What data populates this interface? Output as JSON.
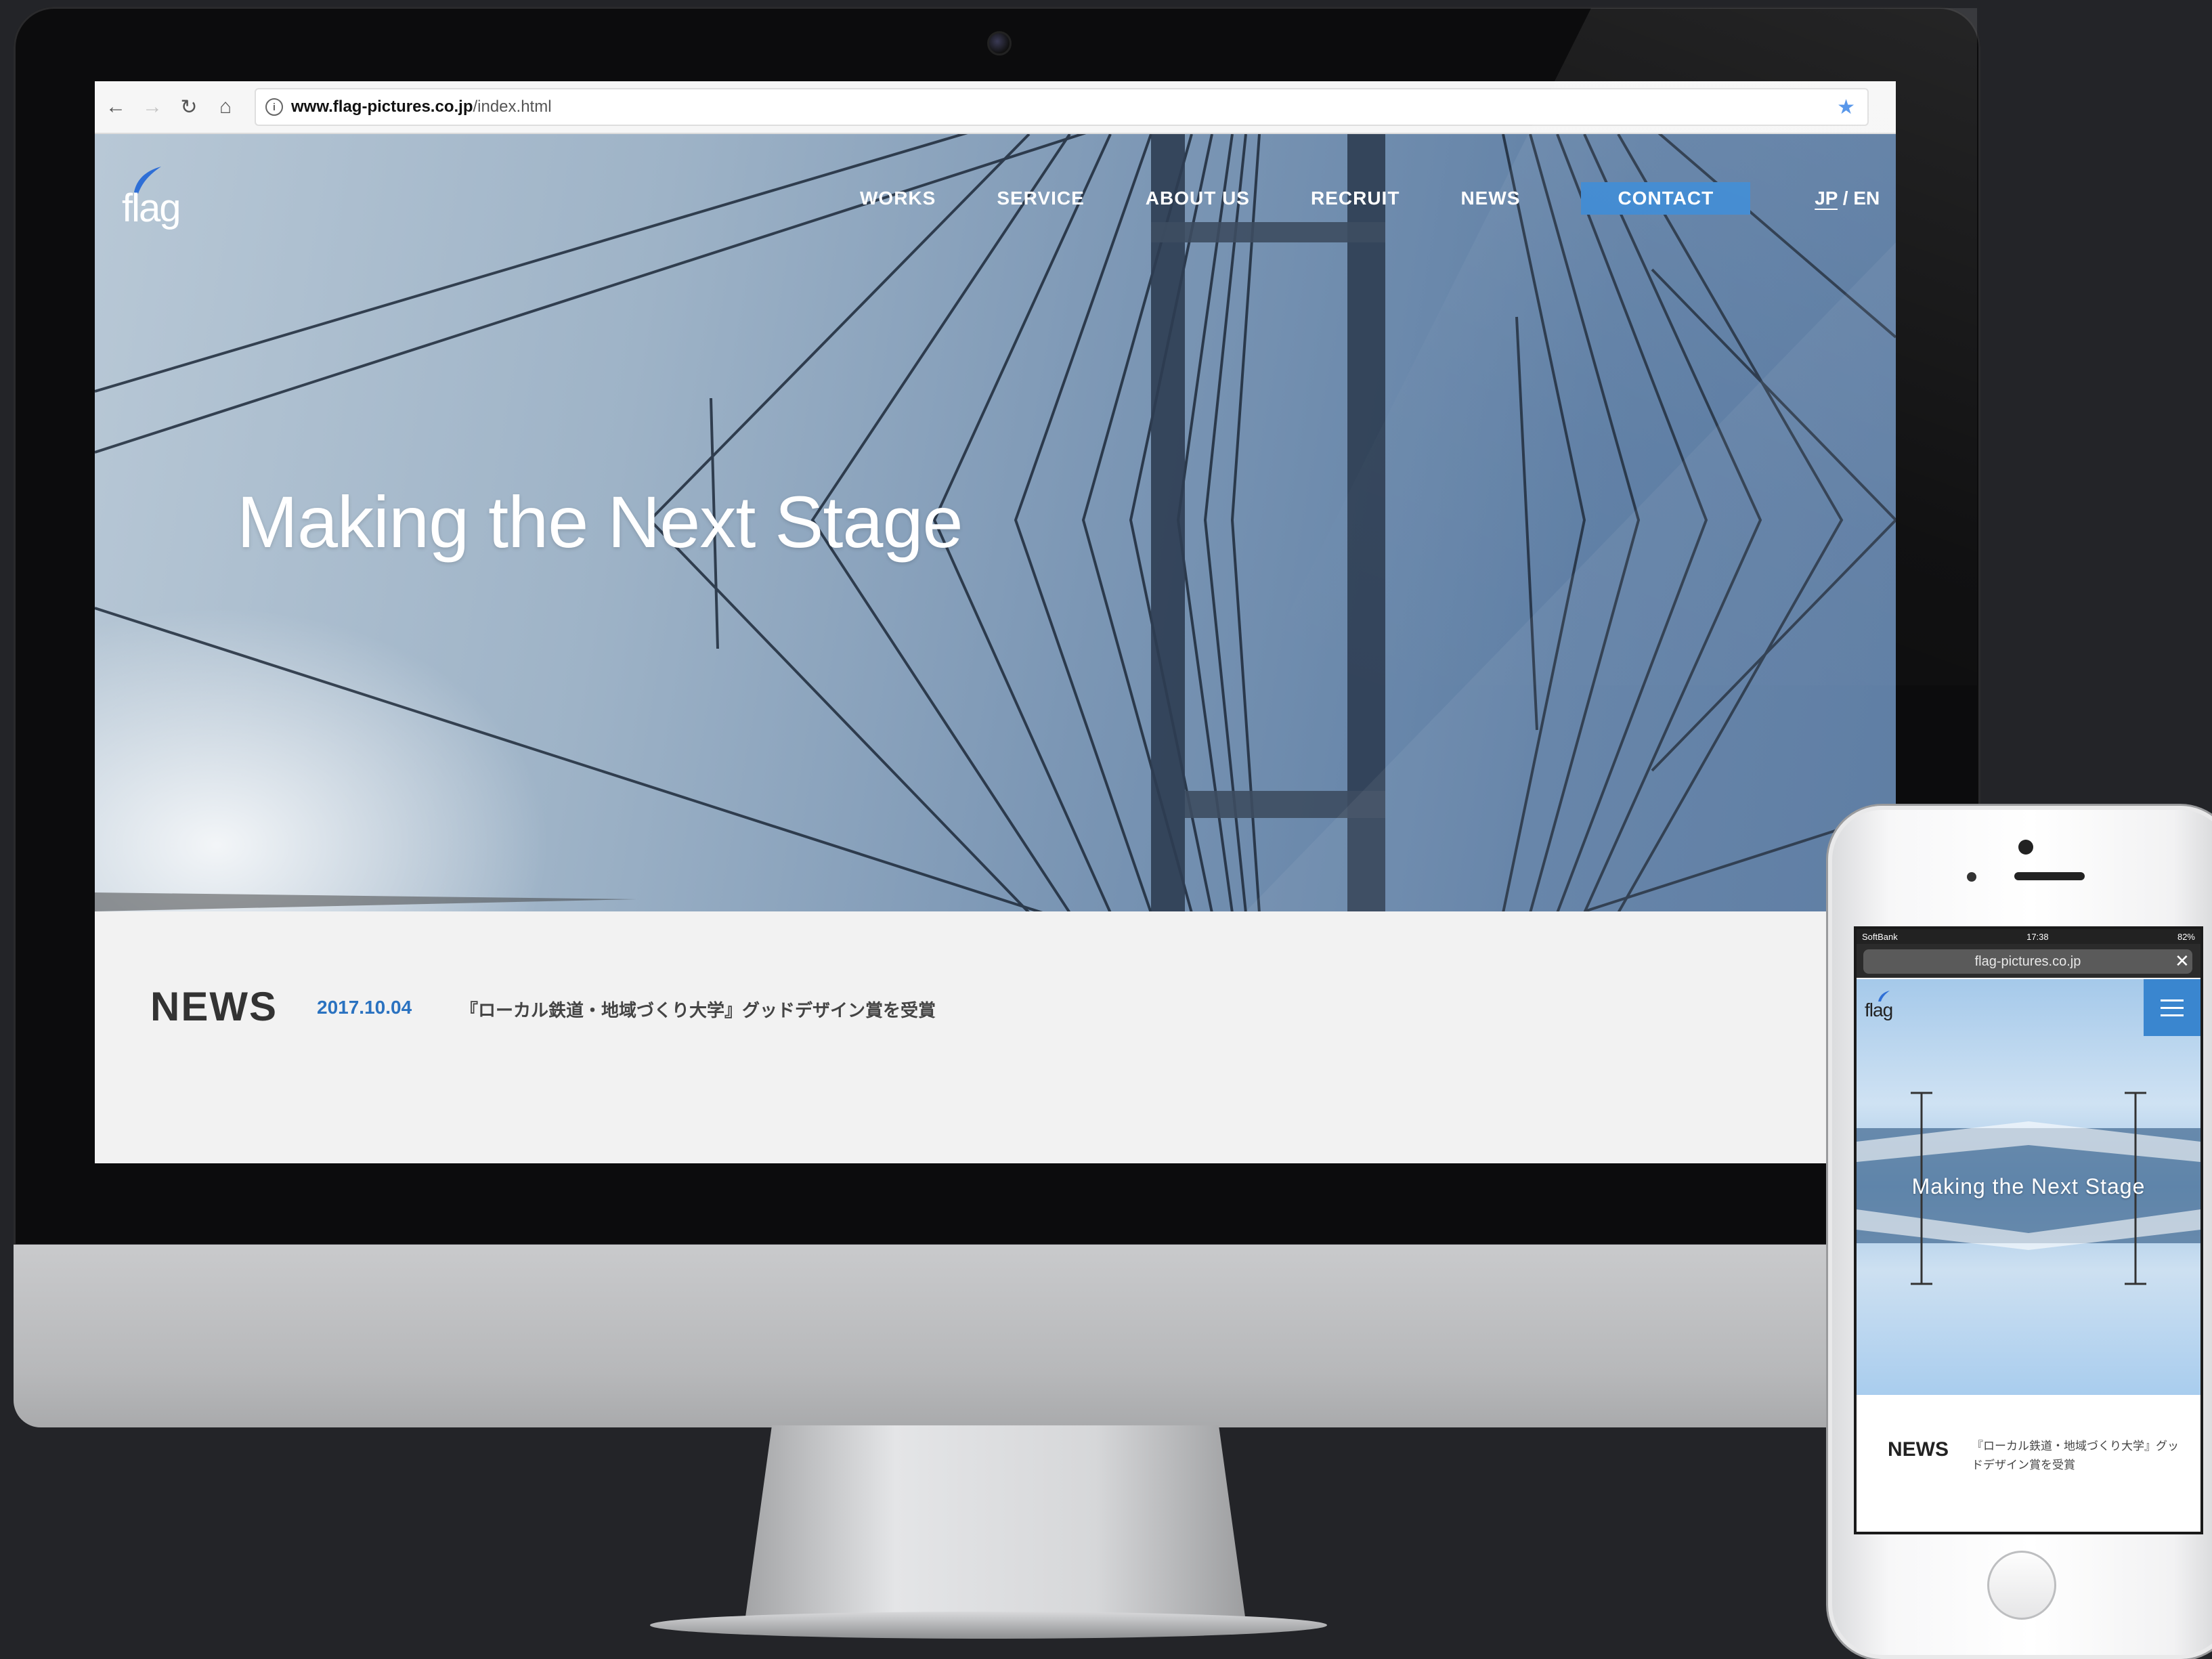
{
  "browser": {
    "url_host": "www.flag-pictures.co.jp",
    "url_path": "/index.html",
    "back_icon": "←",
    "forward_icon": "→",
    "reload_icon": "↻",
    "home_icon": "⌂",
    "info_icon": "i",
    "star_icon": "★"
  },
  "site": {
    "logo": "flag",
    "nav": {
      "works": "WORKS",
      "service": "SERVICE",
      "about": "ABOUT US",
      "recruit": "RECRUIT",
      "news": "NEWS",
      "contact": "CONTACT",
      "lang_jp": "JP",
      "lang_sep": " / ",
      "lang_en": "EN"
    },
    "hero_title": "Making the Next Stage",
    "news": {
      "label": "NEWS",
      "date": "2017.10.04",
      "title": "『ローカル鉄道・地域づくり大学』グッドデザイン賞を受賞"
    }
  },
  "phone": {
    "status": {
      "carrier": "SoftBank",
      "time": "17:38",
      "battery": "82%"
    },
    "url": "flag-pictures.co.jp",
    "close_icon": "✕",
    "logo": "flag",
    "hero_title": "Making the Next Stage",
    "news_label": "NEWS",
    "news_title": "『ローカル鉄道・地域づくり大学』グッドデザイン賞を受賞"
  },
  "colors": {
    "accent": "#3a86cf",
    "news_date": "#2a72c0",
    "background": "#232428"
  }
}
